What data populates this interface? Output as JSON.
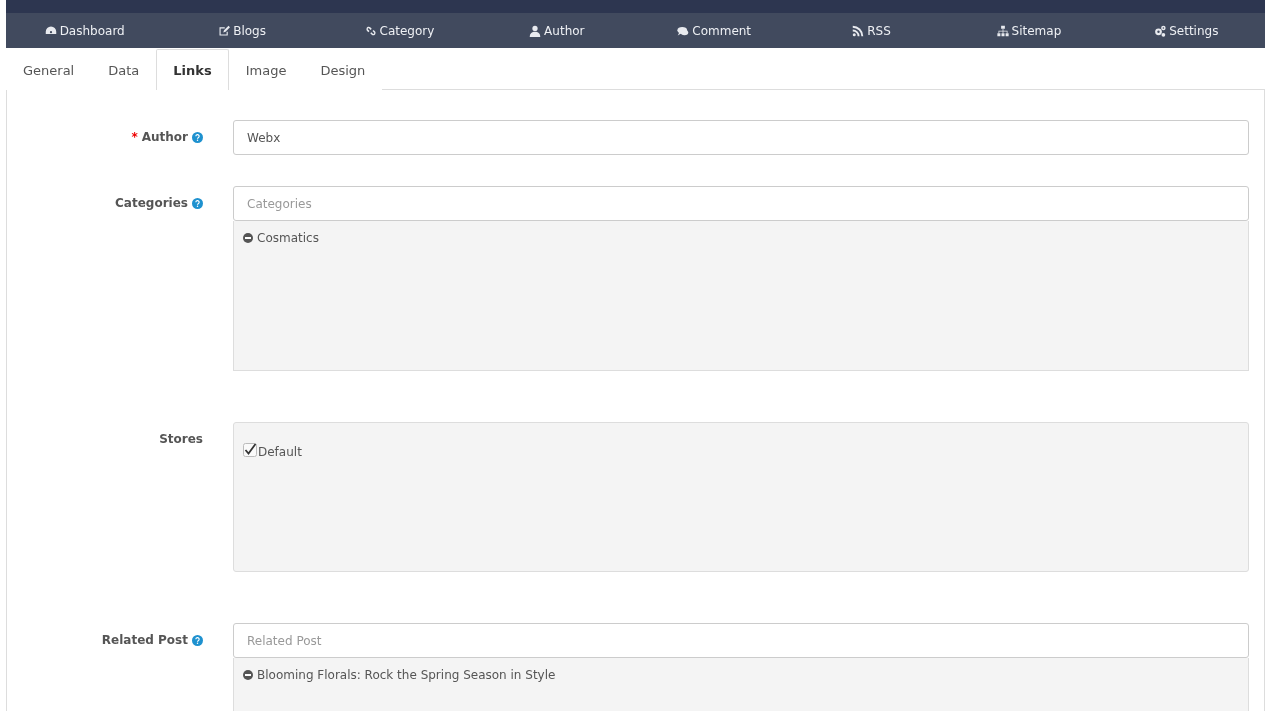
{
  "nav": [
    {
      "label": "Dashboard"
    },
    {
      "label": "Blogs"
    },
    {
      "label": "Category"
    },
    {
      "label": "Author"
    },
    {
      "label": "Comment"
    },
    {
      "label": "RSS"
    },
    {
      "label": "Sitemap"
    },
    {
      "label": "Settings"
    }
  ],
  "tabs": [
    {
      "label": "General",
      "selected": false
    },
    {
      "label": "Data",
      "selected": false
    },
    {
      "label": "Links",
      "selected": true
    },
    {
      "label": "Image",
      "selected": false
    },
    {
      "label": "Design",
      "selected": false
    }
  ],
  "fields": [
    {
      "kind": "input",
      "label": "Author",
      "required_mark": "*",
      "help": true,
      "value": "Webx"
    },
    {
      "kind": "autocomplete",
      "label": "Categories",
      "help": true,
      "placeholder": "Categories",
      "items": [
        "Cosmatics"
      ]
    },
    {
      "kind": "checklist",
      "label": "Stores",
      "help": false,
      "items": [
        {
          "label": "Default",
          "checked": true
        }
      ]
    },
    {
      "kind": "autocomplete",
      "label": "Related Post",
      "help": true,
      "placeholder": "Related Post",
      "items": [
        "Blooming Florals: Rock the Spring Season in Style"
      ]
    }
  ]
}
